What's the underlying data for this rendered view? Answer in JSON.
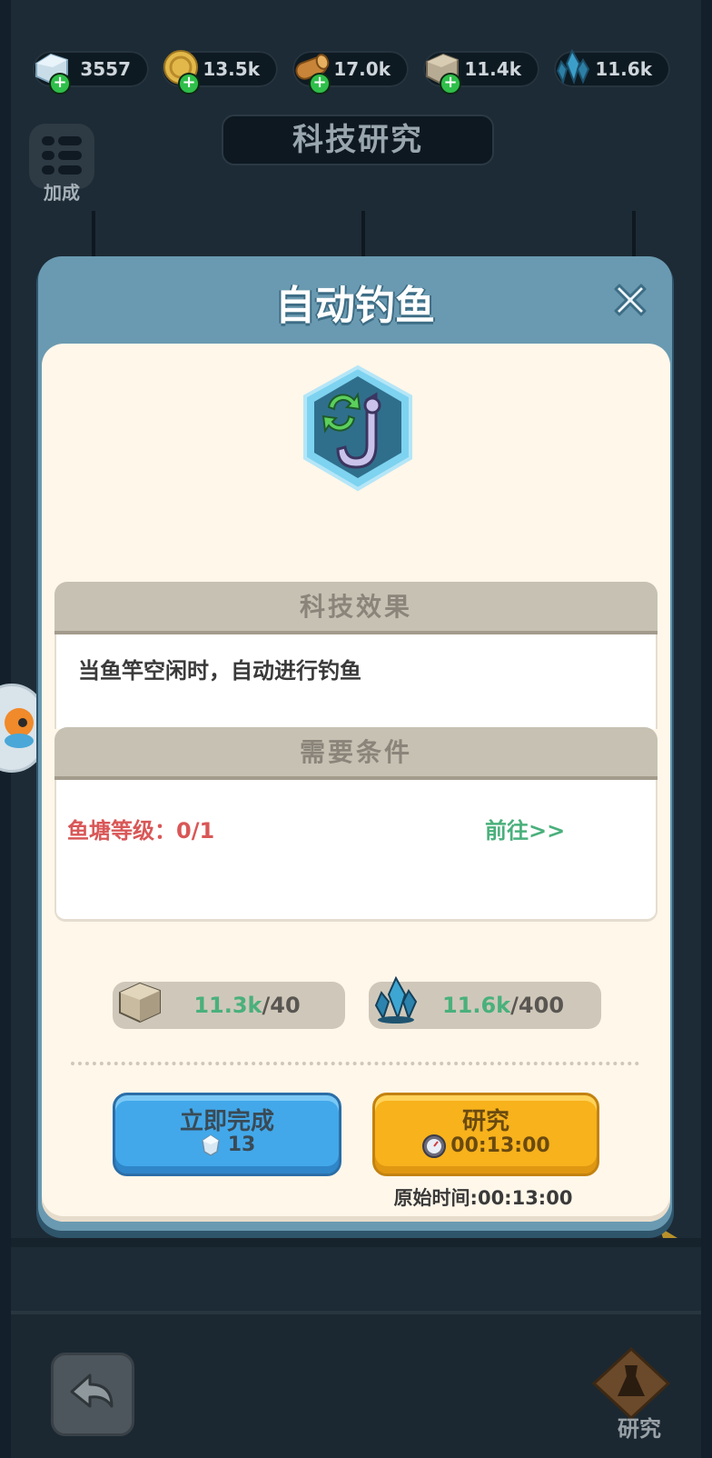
{
  "resources": [
    {
      "name": "ice-block",
      "value": "3557",
      "has_plus": true
    },
    {
      "name": "coin",
      "value": "13.5k",
      "has_plus": true
    },
    {
      "name": "wood-log",
      "value": "17.0k",
      "has_plus": true
    },
    {
      "name": "stone-block",
      "value": "11.4k",
      "has_plus": true
    },
    {
      "name": "blue-crystal",
      "value": "11.6k",
      "has_plus": false
    }
  ],
  "screen_title": "科技研究",
  "bonus_label": "加成",
  "modal": {
    "title": "自动钓鱼",
    "tech_icon": "auto-fishing-hook-icon",
    "effect_header": "科技效果",
    "effect_text": "当鱼竿空闲时，自动进行钓鱼",
    "requirement_header": "需要条件",
    "requirement_text": "鱼塘等级：0/1",
    "goto_label": "前往>>",
    "costs": [
      {
        "icon": "stone-block",
        "have": "11.3k",
        "need": "/40"
      },
      {
        "icon": "blue-crystal",
        "have": "11.6k",
        "need": "/400"
      }
    ],
    "instant_button": {
      "label": "立即完成",
      "gem_cost": "13"
    },
    "research_button": {
      "label": "研究",
      "time": "00:13:00"
    },
    "original_time": "原始时间:00:13:00"
  },
  "bottom": {
    "research_tab_label": "研究"
  },
  "colors": {
    "accent_blue": "#42a8ea",
    "accent_yellow": "#f7b21c",
    "have_green": "#4ab07c",
    "warn_red": "#d95757"
  }
}
